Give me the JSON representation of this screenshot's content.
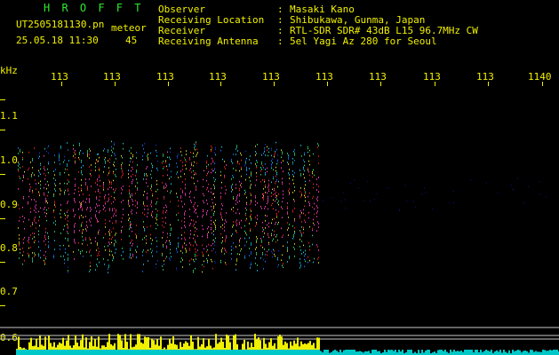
{
  "header": {
    "app_title": "H R O F F T",
    "file_name": "UT2505181130.pn",
    "meteor_label": "meteor",
    "date_time": "25.05.18 11:30",
    "meteor_count": "45"
  },
  "info": [
    {
      "label": "Observer",
      "value": "Masaki Kano"
    },
    {
      "label": "Receiving Location",
      "value": "Shibukawa, Gunma, Japan"
    },
    {
      "label": "Receiver",
      "value": "RTL-SDR SDR# 43dB L15 96.7MHz CW"
    },
    {
      "label": "Receiving Antenna",
      "value": "5el Yagi Az 280 for Seoul"
    }
  ],
  "axis": {
    "y_unit": "kHz",
    "x_ticks": [
      "113",
      "113",
      "113",
      "113",
      "113",
      "113",
      "113",
      "113",
      "113",
      "1140"
    ],
    "y_ticks": [
      "1.1",
      "1.0",
      "0.9",
      "0.8",
      "0.7",
      "0.6"
    ]
  },
  "colors": {
    "text": "#f0f000",
    "title": "#2ee82e",
    "background": "#000000",
    "signal_fill": "#f0f000",
    "signal_base": "#00c8c8"
  }
}
